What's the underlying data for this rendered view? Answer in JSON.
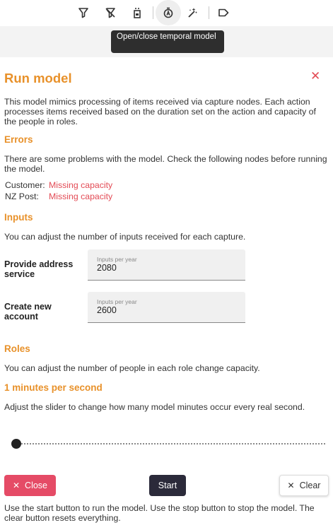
{
  "toolbar": {
    "icons": [
      "filter-icon",
      "filter-off-icon",
      "timer-icon",
      "stopwatch-icon",
      "magic-wand-icon",
      "tag-icon"
    ],
    "tooltip": "Open/close temporal model"
  },
  "dialog": {
    "title": "Run model",
    "close_glyph": "✕",
    "description": "This model mimics processing of items received via capture nodes. Each action processes items received based on the duration set on the action and capacity of the people in roles.",
    "errors": {
      "heading": "Errors",
      "text": "There are some problems with the model. Check the following nodes before running the model.",
      "items": [
        {
          "node": "Customer:",
          "issue": "Missing capacity"
        },
        {
          "node": "NZ Post:",
          "issue": "Missing capacity"
        }
      ]
    },
    "inputs": {
      "heading": "Inputs",
      "text": "You can adjust the number of inputs received for each capture.",
      "fields": [
        {
          "label": "Provide address service",
          "placeholder": "Inputs per year",
          "value": "2080"
        },
        {
          "label": "Create new account",
          "placeholder": "Inputs per year",
          "value": "2600"
        }
      ]
    },
    "roles": {
      "heading": "Roles",
      "text": "You can adjust the number of people in each role change capacity."
    },
    "speed": {
      "heading": "1 minutes per second",
      "text": "Adjust the slider to change how many model minutes occur every real second.",
      "slider_value": 1
    },
    "buttons": {
      "close": "Close",
      "start": "Start",
      "clear": "Clear",
      "x_glyph": "✕"
    },
    "footer": "Use the start button to run the model. Use the stop button to stop the model. The clear button resets everything."
  },
  "colors": {
    "accent": "#e8912a",
    "error": "#e34b55",
    "close_button": "#e54b66",
    "start_button": "#2b2a3a"
  }
}
